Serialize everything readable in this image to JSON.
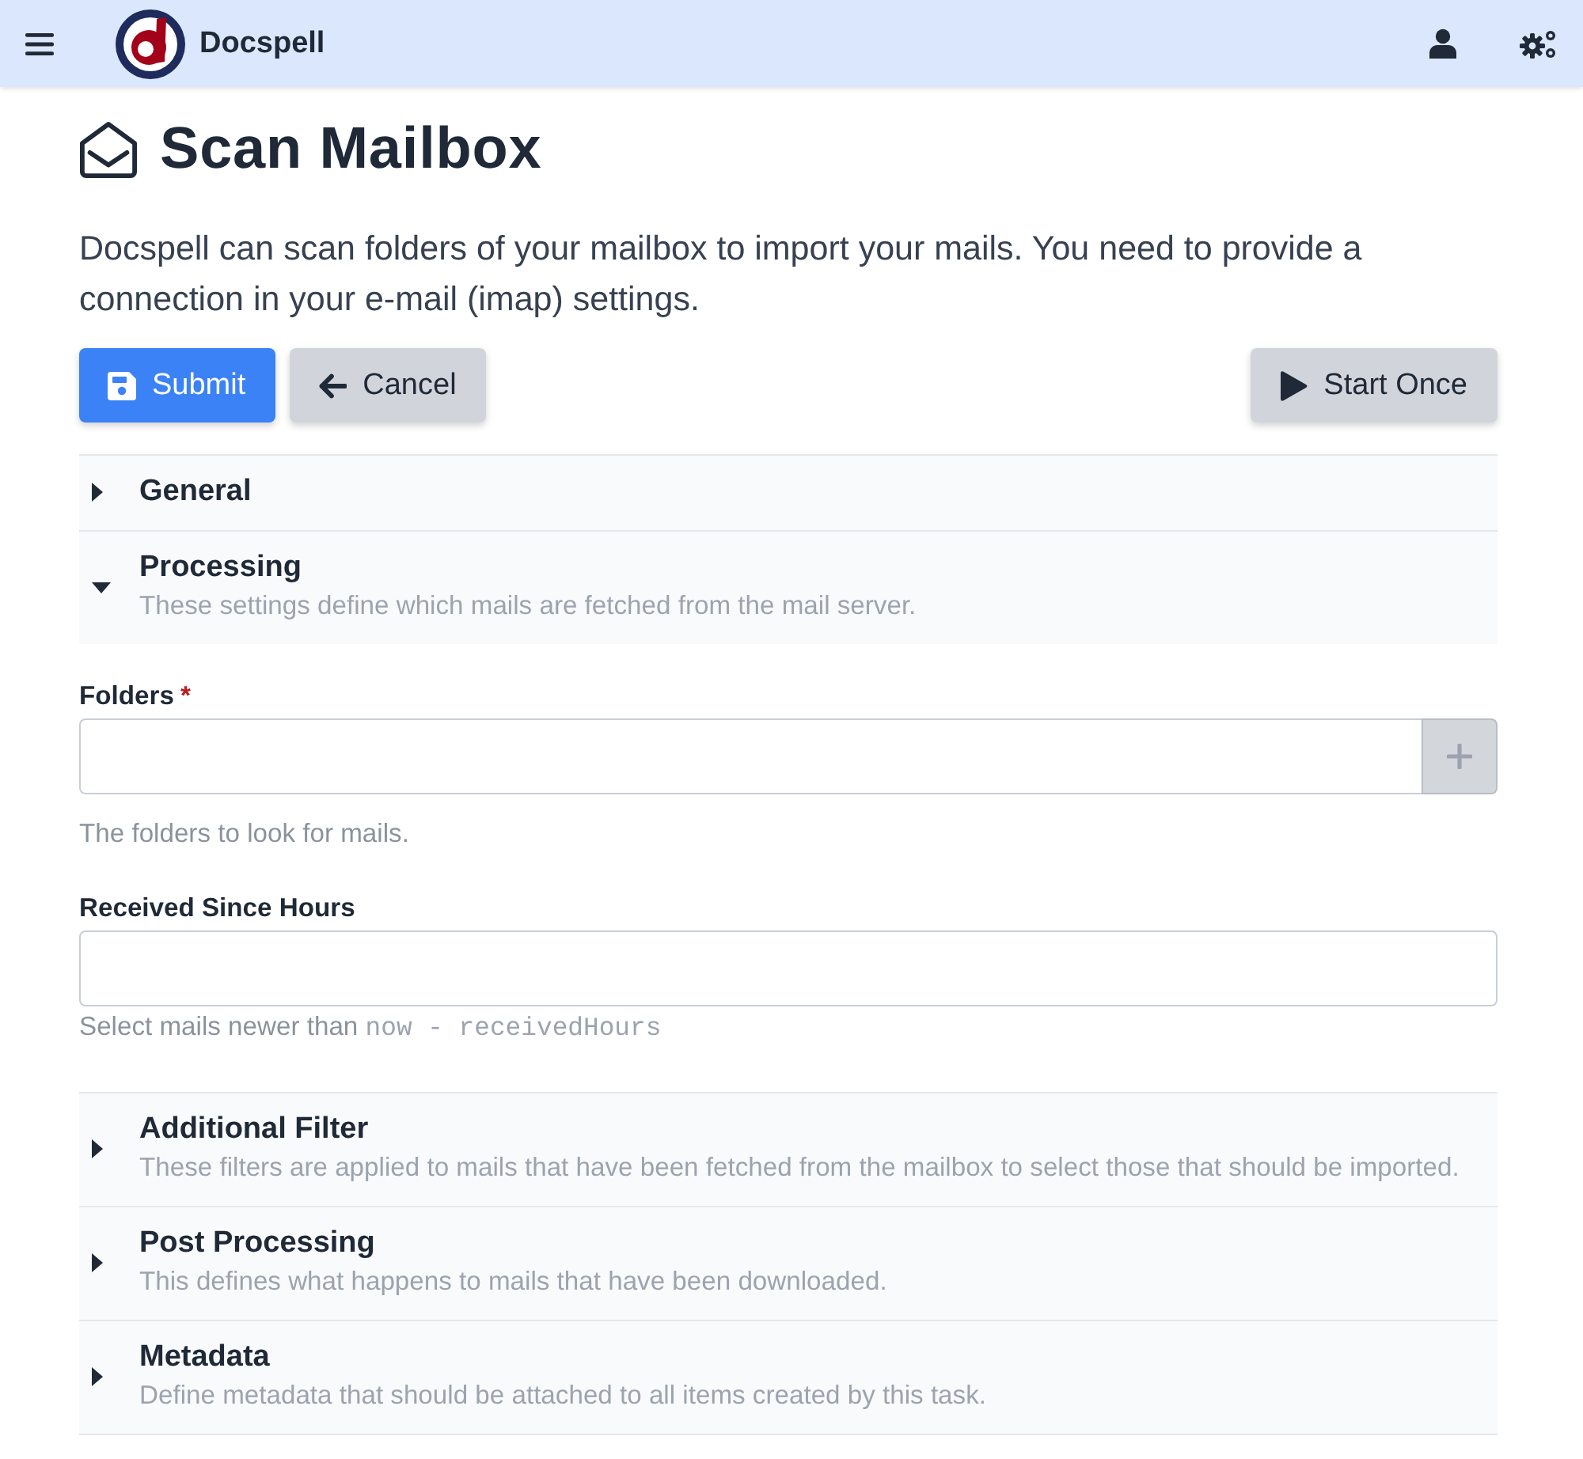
{
  "navbar": {
    "brand": "Docspell"
  },
  "page": {
    "title": "Scan Mailbox",
    "intro": "Docspell can scan folders of your mailbox to import your mails. You need to provide a connection in your e-mail (imap) settings."
  },
  "actions": [
    {
      "kind": "submit",
      "label": "Submit"
    },
    {
      "kind": "cancel",
      "label": "Cancel"
    },
    {
      "kind": "start",
      "label": "Start Once"
    }
  ],
  "sections": [
    {
      "title": "General",
      "expanded": false
    },
    {
      "title": "Processing",
      "description": "These settings define which mails are fetched from the mail server.",
      "expanded": true,
      "fields": [
        {
          "kind": "list",
          "label": "Folders",
          "required_mark": "*",
          "help": "The folders to look for mails."
        },
        {
          "kind": "text",
          "label": "Received Since Hours",
          "help": "Select mails newer than",
          "help_code": "now - receivedHours"
        }
      ]
    },
    {
      "title": "Additional Filter",
      "description": "These filters are applied to mails that have been fetched from the mailbox to select those that should be imported.",
      "expanded": false
    },
    {
      "title": "Post Processing",
      "description": "This defines what happens to mails that have been downloaded.",
      "expanded": false
    },
    {
      "title": "Metadata",
      "description": "Define metadata that should be attached to all items created by this task.",
      "expanded": false
    }
  ]
}
